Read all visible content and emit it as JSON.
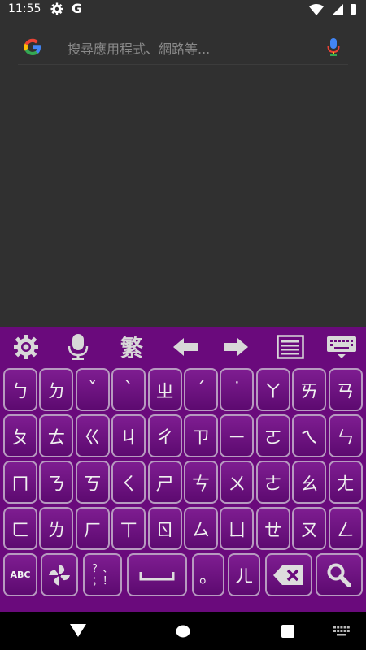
{
  "status_bar": {
    "time": "11:55",
    "google_letter": "G"
  },
  "search": {
    "placeholder": "搜尋應用程式、網路等..."
  },
  "toolbar": {
    "traditional_label": "繁"
  },
  "keyboard": {
    "row1": [
      "ㄅ",
      "ㄉ",
      "ˇ",
      "ˋ",
      "ㄓ",
      "ˊ",
      "˙",
      "ㄚ",
      "ㄞ",
      "ㄢ"
    ],
    "row2": [
      "ㄆ",
      "ㄊ",
      "ㄍ",
      "ㄐ",
      "ㄔ",
      "ㄗ",
      "ㄧ",
      "ㄛ",
      "ㄟ",
      "ㄣ"
    ],
    "row3": [
      "ㄇ",
      "ㄋ",
      "ㄎ",
      "ㄑ",
      "ㄕ",
      "ㄘ",
      "ㄨ",
      "ㄜ",
      "ㄠ",
      "ㄤ"
    ],
    "row4": [
      "ㄈ",
      "ㄌ",
      "ㄏ",
      "ㄒ",
      "ㄖ",
      "ㄙ",
      "ㄩ",
      "ㄝ",
      "ㄡ",
      "ㄥ"
    ],
    "abc_label": "ABC",
    "punct_label": "？、\n；！",
    "period_label": "。",
    "er_label": "ㄦ"
  }
}
